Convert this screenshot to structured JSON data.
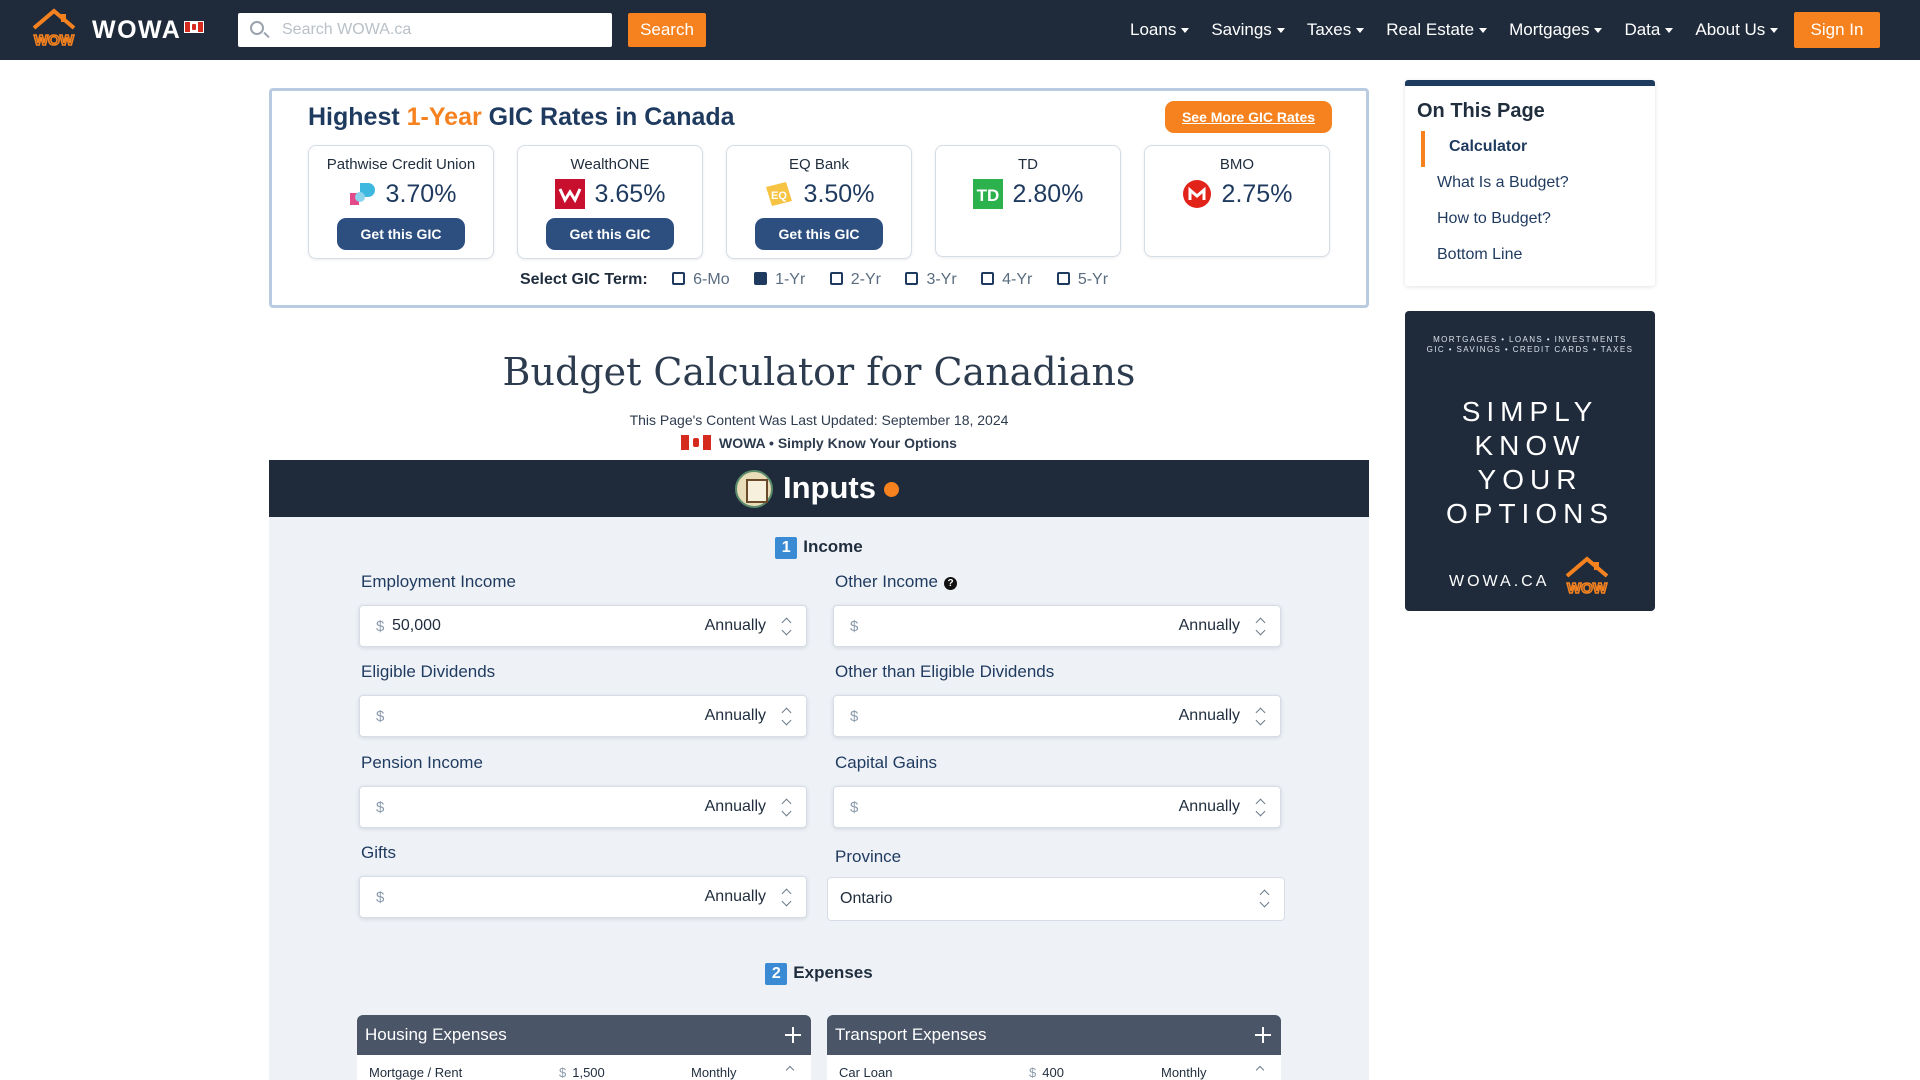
{
  "nav": {
    "brand": "WOWA",
    "search_placeholder": "Search WOWA.ca",
    "search_button": "Search",
    "menu": [
      "Loans",
      "Savings",
      "Taxes",
      "Real Estate",
      "Mortgages",
      "Data",
      "About Us"
    ],
    "sign_in": "Sign In",
    "accent_color": "#f5821f",
    "bg_color": "#1f2b3b"
  },
  "gic": {
    "title_pre": "Highest",
    "title_accent": "1-Year",
    "title_post": "GIC Rates in Canada",
    "see_more": "See More GIC Rates",
    "get_label": "Get this GIC",
    "cards": [
      {
        "bank": "Pathwise Credit Union",
        "rate": "3.70%",
        "icon": "pathwise-logo-icon"
      },
      {
        "bank": "WealthONE",
        "rate": "3.65%",
        "icon": "wealthone-logo-icon"
      },
      {
        "bank": "EQ Bank",
        "rate": "3.50%",
        "icon": "eq-bank-logo-icon"
      },
      {
        "bank": "TD",
        "rate": "2.80%",
        "icon": "td-logo-icon"
      },
      {
        "bank": "BMO",
        "rate": "2.75%",
        "icon": "bmo-logo-icon"
      }
    ],
    "term_label": "Select GIC Term:",
    "terms": [
      "6-Mo",
      "1-Yr",
      "2-Yr",
      "3-Yr",
      "4-Yr",
      "5-Yr"
    ],
    "selected_term": "1-Yr"
  },
  "page": {
    "title": "Budget Calculator for Canadians",
    "updated": "This Page's Content Was Last Updated: September 18, 2024",
    "tagline": "WOWA • Simply Know Your Options"
  },
  "inputs": {
    "title": "Inputs",
    "income_num": "1",
    "income_heading": "Income",
    "currency": "$",
    "fields": {
      "employment": {
        "label": "Employment Income",
        "value": "50,000",
        "freq": "Annually"
      },
      "other": {
        "label": "Other Income",
        "value": "",
        "freq": "Annually"
      },
      "eligible_div": {
        "label": "Eligible Dividends",
        "value": "",
        "freq": "Annually"
      },
      "other_div": {
        "label": "Other than Eligible Dividends",
        "value": "",
        "freq": "Annually"
      },
      "pension": {
        "label": "Pension Income",
        "value": "",
        "freq": "Annually"
      },
      "capital": {
        "label": "Capital Gains",
        "value": "",
        "freq": "Annually"
      },
      "gifts": {
        "label": "Gifts",
        "value": "",
        "freq": "Annually"
      }
    },
    "province_label": "Province",
    "province_value": "Ontario",
    "expenses_num": "2",
    "expenses_heading": "Expenses",
    "housing": {
      "title": "Housing Expenses",
      "row_label": "Mortgage / Rent",
      "row_value": "1,500",
      "row_freq": "Monthly"
    },
    "transport": {
      "title": "Transport Expenses",
      "row_label": "Car Loan",
      "row_value": "400",
      "row_freq": "Monthly"
    }
  },
  "toc": {
    "heading": "On This Page",
    "items": [
      "Calculator",
      "What Is a Budget?",
      "How to Budget?",
      "Bottom Line"
    ],
    "active": "Calculator"
  },
  "ad": {
    "line1": "MORTGAGES • LOANS • INVESTMENTS",
    "line2": "GIC • SAVINGS • CREDIT CARDS • TAXES",
    "big1": "SIMPLY",
    "big2": "KNOW",
    "big3": "YOUR",
    "big4": "OPTIONS",
    "site": "WOWA.CA"
  }
}
